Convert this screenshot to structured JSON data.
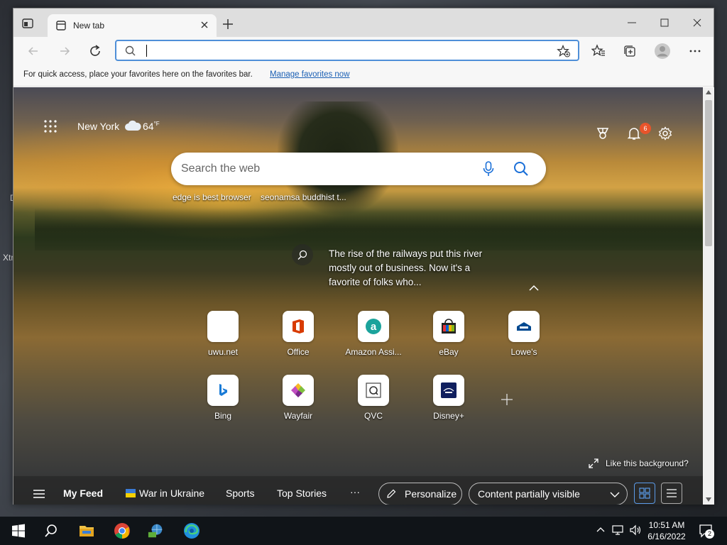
{
  "desktop": {
    "fragments": [
      "D",
      "Xtr"
    ]
  },
  "tab": {
    "title": "New tab"
  },
  "address_bar": {
    "value": "",
    "placeholder": ""
  },
  "favorites_bar": {
    "message": "For quick access, place your favorites here on the favorites bar.",
    "link": "Manage favorites now"
  },
  "newtab": {
    "weather": {
      "city": "New York",
      "temp": "64",
      "unit": "°F"
    },
    "notifications_count": "6",
    "search": {
      "placeholder": "Search the web"
    },
    "trending": [
      "edge is best browser",
      "seonamsa buddhist t..."
    ],
    "caption": "The rise of the railways put this river mostly out of business. Now it's a favorite of folks who...",
    "tiles": [
      {
        "label": "uwu.net",
        "icon": "blank-icon"
      },
      {
        "label": "Office",
        "icon": "office-icon"
      },
      {
        "label": "Amazon Assi...",
        "icon": "amazon-icon"
      },
      {
        "label": "eBay",
        "icon": "ebay-icon"
      },
      {
        "label": "Lowe's",
        "icon": "lowes-icon"
      },
      {
        "label": "Bing",
        "icon": "bing-icon"
      },
      {
        "label": "Wayfair",
        "icon": "wayfair-icon"
      },
      {
        "label": "QVC",
        "icon": "qvc-icon"
      },
      {
        "label": "Disney+",
        "icon": "disney-icon"
      }
    ],
    "like_background": "Like this background?",
    "feed": {
      "items": [
        "My Feed",
        "War in Ukraine",
        "Sports",
        "Top Stories"
      ],
      "more": "···",
      "personalize": "Personalize",
      "visibility": "Content partially visible"
    }
  },
  "taskbar": {
    "time": "10:51 AM",
    "date": "6/16/2022",
    "notifications": "2"
  },
  "colors": {
    "accent": "#4f8fd8",
    "link": "#1a5fb4",
    "badge": "#e8542b",
    "taskbar": "#101418"
  }
}
